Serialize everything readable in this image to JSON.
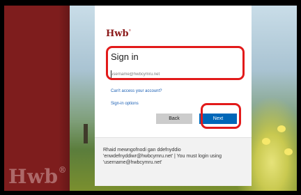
{
  "background": {
    "brand_name": "Hwb",
    "brand_mark": "®"
  },
  "signin": {
    "logo": "Hwb",
    "logo_mark": "°",
    "title": "Sign in",
    "email_placeholder": "username@hwbcymru.net",
    "cant_access_link": "Can't access your account?",
    "options_link": "Sign-in options",
    "back_button": "Back",
    "next_button": "Next",
    "footer_text": "Rhaid mewngofnodi gan ddefnyddio 'enwdefnyddiwr@hwbcymru.net' | You must login using 'username@hwbcymru.net'"
  },
  "colors": {
    "brand_red": "#7e1d1d",
    "next_blue": "#0067b8",
    "annotation_red": "#e21a1a"
  }
}
